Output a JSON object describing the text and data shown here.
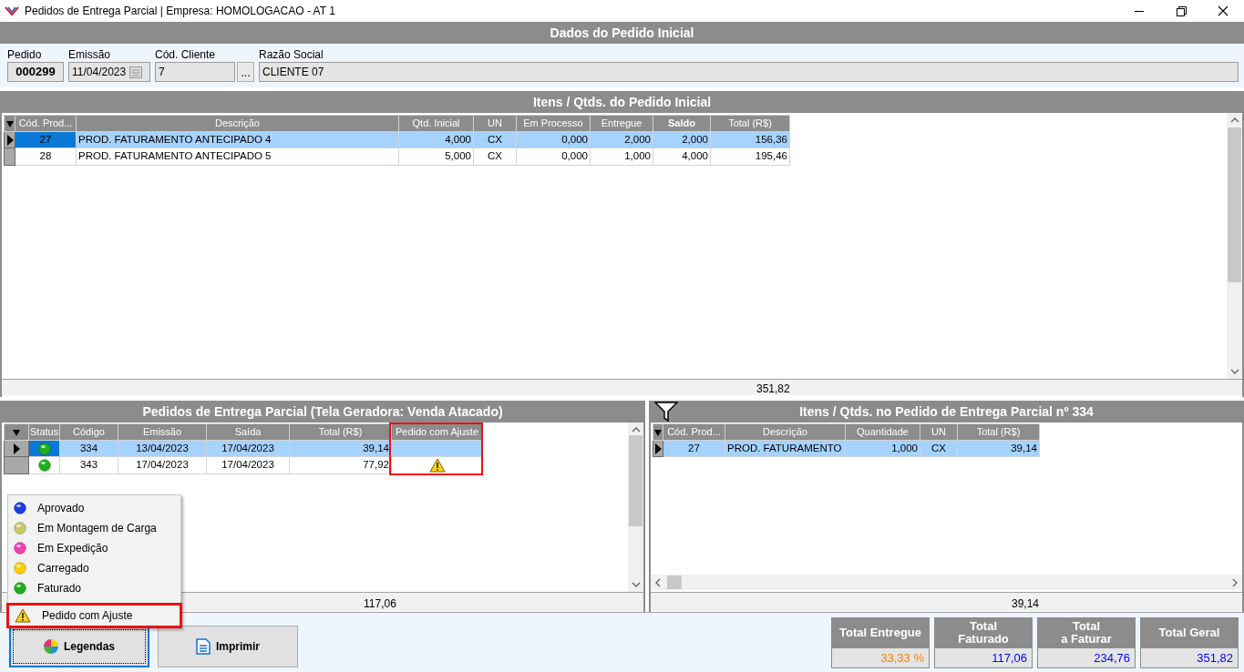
{
  "window": {
    "title": "Pedidos de Entrega Parcial | Empresa: HOMOLOGACAO - AT 1"
  },
  "initial_order": {
    "title": "Dados do Pedido Inicial",
    "fields": [
      {
        "label": "Pedido",
        "value": "000299",
        "kind": "code"
      },
      {
        "label": "Emissão",
        "value": "11/04/2023",
        "kind": "date"
      },
      {
        "label": "Cód. Cliente",
        "value": "7",
        "kind": "lookup",
        "button": "..."
      },
      {
        "label": "Razão Social",
        "value": "CLIENTE 07",
        "kind": "text"
      }
    ]
  },
  "initial_items": {
    "title": "Itens / Qtds. do Pedido Inicial",
    "columns": [
      {
        "label": "Cód. Prod...",
        "emphasized": false
      },
      {
        "label": "Descrição",
        "emphasized": false
      },
      {
        "label": "Qtd. Inicial",
        "emphasized": false
      },
      {
        "label": "UN",
        "emphasized": false
      },
      {
        "label": "Em Processo",
        "emphasized": false
      },
      {
        "label": "Entregue",
        "emphasized": false
      },
      {
        "label": "Saldo",
        "emphasized": true
      },
      {
        "label": "Total (R$)",
        "emphasized": false
      }
    ],
    "rows": [
      {
        "cells": [
          "27",
          "PROD. FATURAMENTO ANTECIPADO 4",
          "4,000",
          "CX",
          "0,000",
          "2,000",
          "2,000",
          "156,36"
        ],
        "selected": true
      },
      {
        "cells": [
          "28",
          "PROD. FATURAMENTO ANTECIPADO 5",
          "5,000",
          "CX",
          "0,000",
          "1,000",
          "4,000",
          "195,46"
        ],
        "selected": false
      }
    ],
    "total": "351,82"
  },
  "partial_orders": {
    "title": "Pedidos de Entrega Parcial (Tela Geradora: Venda Atacado)",
    "columns": [
      {
        "label": "Status",
        "highlighted": false
      },
      {
        "label": "Código",
        "highlighted": false
      },
      {
        "label": "Emissão",
        "highlighted": false
      },
      {
        "label": "Saída",
        "highlighted": false
      },
      {
        "label": "Total (R$)",
        "highlighted": false
      },
      {
        "label": "Pedido com Ajuste",
        "highlighted": true
      }
    ],
    "rows": [
      {
        "color": "#1fae1f",
        "cells": [
          "",
          "334",
          "13/04/2023",
          "17/04/2023",
          "39,14",
          ""
        ],
        "adjusted": false,
        "selected": true
      },
      {
        "color": "#1fae1f",
        "cells": [
          "",
          "343",
          "17/04/2023",
          "17/04/2023",
          "77,92",
          ""
        ],
        "adjusted": true,
        "selected": false
      }
    ],
    "total": "117,06"
  },
  "partial_items": {
    "title": "Itens / Qtds. no Pedido de Entrega Parcial nº 334",
    "columns": [
      {
        "label": "Cód. Prod..."
      },
      {
        "label": "Descrição"
      },
      {
        "label": "Quantidade"
      },
      {
        "label": "UN"
      },
      {
        "label": "Total (R$)"
      }
    ],
    "rows": [
      {
        "cells": [
          "27",
          "PROD. FATURAMENTO",
          "1,000",
          "CX",
          "39,14"
        ],
        "selected": true
      }
    ],
    "total": "39,14"
  },
  "legend": {
    "items": [
      {
        "label": "Aprovado",
        "kind": "dot",
        "color": "#1a3fe0",
        "highlighted": false
      },
      {
        "label": "Em Montagem de Carga",
        "kind": "dot",
        "color": "#c8c86a",
        "highlighted": false
      },
      {
        "label": "Em Expedição",
        "kind": "dot",
        "color": "#f040b0",
        "highlighted": false
      },
      {
        "label": "Carregado",
        "kind": "dot",
        "color": "#ffcc00",
        "highlighted": false
      },
      {
        "label": "Faturado",
        "kind": "dot",
        "color": "#1fae1f",
        "highlighted": false
      },
      {
        "label": "Pedido com Ajuste",
        "kind": "warning",
        "highlighted": true
      }
    ]
  },
  "buttons": [
    {
      "label": "Legendas",
      "kind": "palette",
      "focused": true
    },
    {
      "label": "Imprimir",
      "kind": "document",
      "focused": false
    }
  ],
  "totals": [
    {
      "label": "Total Entregue",
      "value": "33,33 %",
      "color": "#ff7f00"
    },
    {
      "label": "Total\nFaturado",
      "value": "117,06",
      "color": "#0000ff"
    },
    {
      "label": "Total\na Faturar",
      "value": "234,76",
      "color": "#0000ff"
    },
    {
      "label": "Total Geral",
      "value": "351,82",
      "color": "#0000ff"
    }
  ]
}
